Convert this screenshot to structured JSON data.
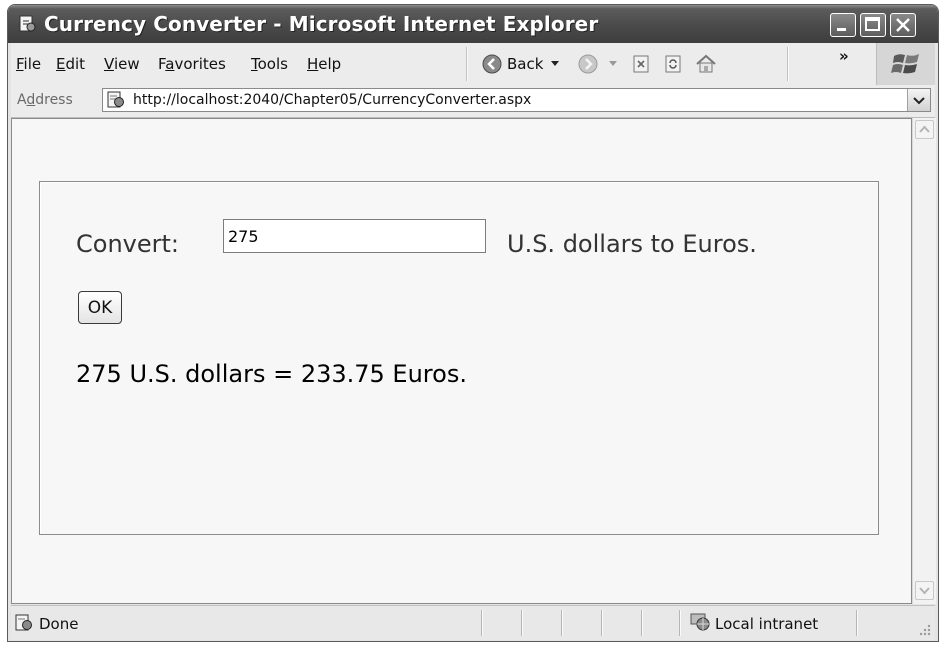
{
  "window": {
    "title": "Currency Converter - Microsoft Internet Explorer",
    "app_icon": "ie-page-icon",
    "caption_buttons": [
      "minimize-icon",
      "maximize-icon",
      "close-icon"
    ]
  },
  "menu": {
    "items": [
      "File",
      "Edit",
      "View",
      "Favorites",
      "Tools",
      "Help"
    ],
    "access_keys": [
      "F",
      "E",
      "V",
      "a",
      "T",
      "H"
    ]
  },
  "toolbar": {
    "back_label": "Back",
    "chevron": "»",
    "icons": [
      "back-arrow-icon",
      "forward-arrow-icon",
      "stop-icon",
      "refresh-icon",
      "home-icon",
      "windows-logo-icon"
    ]
  },
  "address": {
    "label": "Address",
    "access_key": "d",
    "url": "http://localhost:2040/Chapter05/CurrencyConverter.aspx"
  },
  "page": {
    "convert_label": "Convert:",
    "amount_value": "275",
    "suffix_label": "U.S. dollars to Euros.",
    "ok_label": "OK",
    "result_text": "275 U.S. dollars = 233.75 Euros."
  },
  "status": {
    "text": "Done",
    "zone": "Local intranet"
  }
}
